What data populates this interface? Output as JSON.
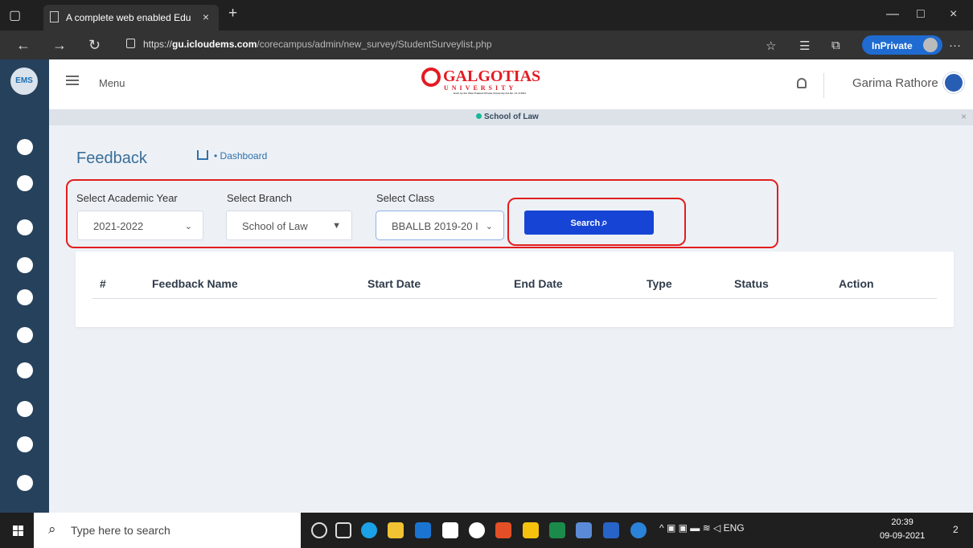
{
  "browser": {
    "tab_title": "A complete web enabled Educati",
    "close_tab": "×",
    "new_tab": "+",
    "url_prefix": "https://",
    "url_host": "gu.icloudems.com",
    "url_path": "/corecampus/admin/new_survey/StudentSurveylist.php",
    "inprivate": "InPrivate",
    "more": "···"
  },
  "header": {
    "menu": "Menu",
    "brand_name": "GALGOTIAS",
    "brand_sub": "UNIVERSITY",
    "brand_tag": "Estd. by the Uttar Pradesh Private University Act No. 14 of 2011",
    "user": "Garima Rathore",
    "school": "School of Law",
    "school_close": "×"
  },
  "page": {
    "title": "Feedback",
    "breadcrumb": "• Dashboard"
  },
  "filters": {
    "academic_year_label": "Select Academic Year",
    "academic_year_value": "2021-2022",
    "branch_label": "Select Branch",
    "branch_value": "School of Law",
    "class_label": "Select Class",
    "class_value": "BBALLB 2019-20 I",
    "search": "Search"
  },
  "table": {
    "headers": [
      "#",
      "Feedback Name",
      "Start Date",
      "End Date",
      "Type",
      "Status",
      "Action"
    ]
  },
  "taskbar": {
    "search": "Type here to search",
    "tray": "ENG",
    "time": "20:39",
    "date": "09-09-2021",
    "notification": "2"
  },
  "colors": {
    "accent": "#1645d6",
    "outline": "#e21e1e",
    "sidebar": "#26415c"
  }
}
